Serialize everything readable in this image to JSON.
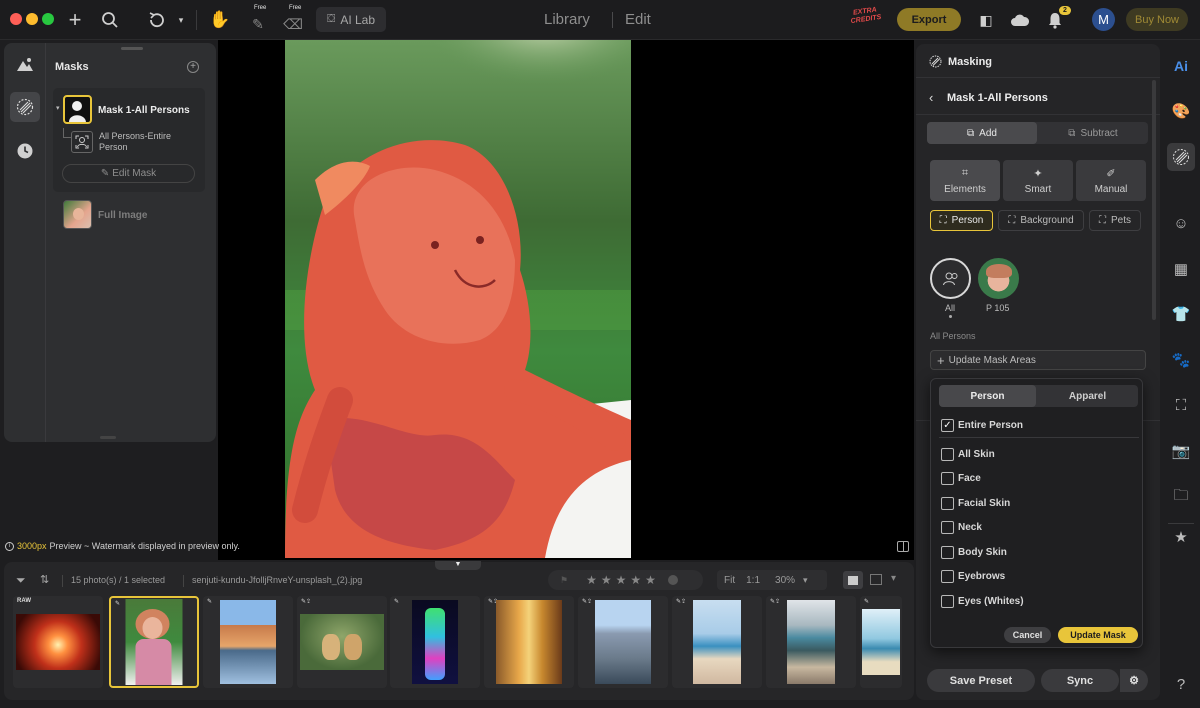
{
  "topbar": {
    "ai_lab": "AI Lab",
    "free_label_1": "Free",
    "free_label_2": "Free",
    "library": "Library",
    "edit": "Edit",
    "extra_credits": "EXTRA CREDITS",
    "export": "Export",
    "notif_count": "2",
    "avatar_letter": "M",
    "buy_now": "Buy Now"
  },
  "left_panel": {
    "title": "Masks",
    "mask_name": "Mask 1-All Persons",
    "sub_item": "All Persons-Entire Person",
    "edit_mask": "Edit Mask",
    "full_image": "Full Image"
  },
  "canvas": {
    "preview_bold": "3000px",
    "preview_rest": "Preview ~ Watermark displayed in preview only."
  },
  "right_panel": {
    "section_title": "Masking",
    "mask_title": "Mask 1-All Persons",
    "add": "Add",
    "subtract": "Subtract",
    "modes": [
      "Elements",
      "Smart",
      "Manual"
    ],
    "chips": [
      "Person",
      "Background",
      "Pets"
    ],
    "people": [
      {
        "label": "All"
      },
      {
        "label": "P 105"
      }
    ],
    "all_persons_label": "All Persons",
    "update_mask_areas": "Update Mask Areas",
    "save_preset": "Save Preset",
    "sync": "Sync"
  },
  "dropdown": {
    "tabs": [
      "Person",
      "Apparel"
    ],
    "options": [
      {
        "label": "Entire Person",
        "checked": true
      },
      {
        "label": "All Skin",
        "checked": false
      },
      {
        "label": "Face",
        "checked": false
      },
      {
        "label": "Facial Skin",
        "checked": false
      },
      {
        "label": "Neck",
        "checked": false
      },
      {
        "label": "Body Skin",
        "checked": false
      },
      {
        "label": "Eyebrows",
        "checked": false
      },
      {
        "label": "Eyes (Whites)",
        "checked": false
      }
    ],
    "cancel": "Cancel",
    "update_mask": "Update Mask"
  },
  "filmstrip": {
    "count_text": "15 photo(s) / 1 selected",
    "filename": "senjuti-kundu-JfolljRnveY-unsplash_(2).jpg",
    "fit": "Fit",
    "one_to_one": "1:1",
    "zoom": "30%",
    "raw_badge": "RAW"
  },
  "colors": {
    "accent_yellow": "#e8c53a",
    "mask_red": "#e0553f",
    "panel_bg": "#252527",
    "avatar_blue": "#2c4f8f"
  }
}
